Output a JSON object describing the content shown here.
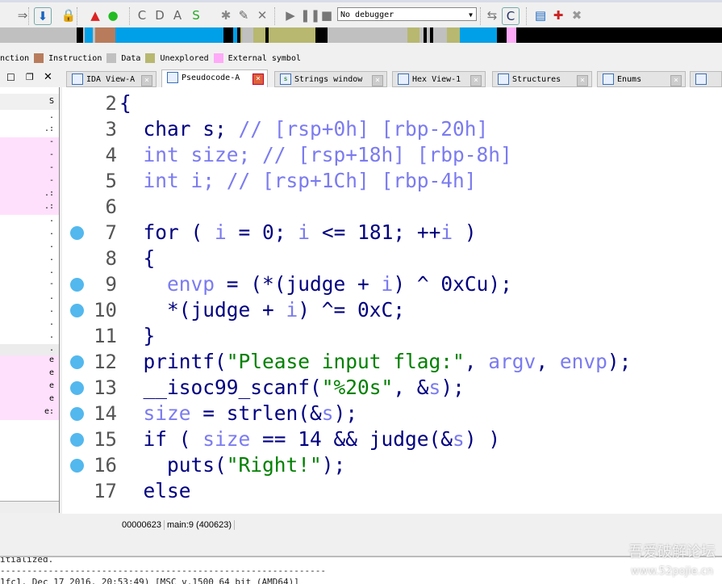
{
  "toolbar": {
    "debugger_select": "No debugger",
    "icons": [
      "jump-icon",
      "nav-down-icon",
      "lock-icon",
      "error-icon",
      "run-green-icon",
      "make-code-icon",
      "make-data-icon",
      "make-ascii-icon",
      "make-string-icon",
      "make-array-icon",
      "rename-icon",
      "undefine-icon",
      "play-icon",
      "pause-icon",
      "stop-icon",
      "attach-icon",
      "decompile-icon",
      "breakpoint-list-icon",
      "add-breakpoint-icon",
      "delete-breakpoint-icon"
    ]
  },
  "legend": [
    {
      "label": "nction",
      "color": null
    },
    {
      "label": "Instruction",
      "color": "#b87c5c"
    },
    {
      "label": "Data",
      "color": "#c0c0c0"
    },
    {
      "label": "Unexplored",
      "color": "#b8b870"
    },
    {
      "label": "External symbol",
      "color": "#ffaaf8"
    }
  ],
  "tabs": [
    {
      "label": "IDA View-A"
    },
    {
      "label": "Pseudocode-A",
      "active": true
    },
    {
      "label": "Strings window"
    },
    {
      "label": "Hex View-1"
    },
    {
      "label": "Structures"
    },
    {
      "label": "Enums"
    }
  ],
  "left_pane": {
    "header": "S",
    "rows": [
      ".",
      ".:",
      "-",
      "-",
      "-",
      "-",
      ".:",
      ".:",
      ".",
      ".",
      ".",
      ".",
      ".",
      "-",
      ".",
      ".",
      ".",
      ".",
      ".",
      "e",
      "e",
      "e",
      "e",
      "e:"
    ]
  },
  "code": {
    "lines": [
      {
        "n": "2",
        "bp": false,
        "segs": [
          [
            "{",
            "k"
          ]
        ]
      },
      {
        "n": "3",
        "bp": false,
        "segs": [
          [
            "  char s; ",
            "k"
          ],
          [
            "// [rsp+0h] [rbp-20h]",
            "v"
          ]
        ]
      },
      {
        "n": "4",
        "bp": false,
        "segs": [
          [
            "  int size; ",
            "v"
          ],
          [
            "// [rsp+18h] [rbp-8h]",
            "v"
          ]
        ]
      },
      {
        "n": "5",
        "bp": false,
        "segs": [
          [
            "  int i; ",
            "v"
          ],
          [
            "// [rsp+1Ch] [rbp-4h]",
            "v"
          ]
        ]
      },
      {
        "n": "6",
        "bp": false,
        "segs": []
      },
      {
        "n": "7",
        "bp": true,
        "segs": [
          [
            "  for ( ",
            "k"
          ],
          [
            "i",
            "v"
          ],
          [
            " = 0; ",
            "k"
          ],
          [
            "i",
            "v"
          ],
          [
            " <= 181; ++",
            "k"
          ],
          [
            "i",
            "v"
          ],
          [
            " )",
            "k"
          ]
        ]
      },
      {
        "n": "8",
        "bp": false,
        "segs": [
          [
            "  {",
            "k"
          ]
        ]
      },
      {
        "n": "9",
        "bp": true,
        "segs": [
          [
            "    ",
            "k"
          ],
          [
            "envp",
            "v"
          ],
          [
            " = (*(judge + ",
            "k"
          ],
          [
            "i",
            "v"
          ],
          [
            ") ^ 0xCu);",
            "k"
          ]
        ]
      },
      {
        "n": "10",
        "bp": true,
        "segs": [
          [
            "    *(judge + ",
            "k"
          ],
          [
            "i",
            "v"
          ],
          [
            ") ^= 0xC;",
            "k"
          ]
        ]
      },
      {
        "n": "11",
        "bp": false,
        "segs": [
          [
            "  }",
            "k"
          ]
        ]
      },
      {
        "n": "12",
        "bp": true,
        "segs": [
          [
            "  printf(",
            "k"
          ],
          [
            "\"Please input flag:\"",
            "s"
          ],
          [
            ", ",
            "k"
          ],
          [
            "argv",
            "v"
          ],
          [
            ", ",
            "k"
          ],
          [
            "envp",
            "v"
          ],
          [
            ");",
            "k"
          ]
        ]
      },
      {
        "n": "13",
        "bp": true,
        "segs": [
          [
            "  __isoc99_scanf(",
            "k"
          ],
          [
            "\"%20s\"",
            "s"
          ],
          [
            ", &",
            "k"
          ],
          [
            "s",
            "v"
          ],
          [
            ");",
            "k"
          ]
        ]
      },
      {
        "n": "14",
        "bp": true,
        "segs": [
          [
            "  ",
            "k"
          ],
          [
            "size",
            "v"
          ],
          [
            " = strlen(&",
            "k"
          ],
          [
            "s",
            "v"
          ],
          [
            ");",
            "k"
          ]
        ]
      },
      {
        "n": "15",
        "bp": true,
        "segs": [
          [
            "  if ( ",
            "k"
          ],
          [
            "size",
            "v"
          ],
          [
            " == 14 && judge(&",
            "k"
          ],
          [
            "s",
            "v"
          ],
          [
            ") )",
            "k"
          ]
        ]
      },
      {
        "n": "16",
        "bp": true,
        "segs": [
          [
            "    puts(",
            "k"
          ],
          [
            "\"Right!\"",
            "s"
          ],
          [
            ");",
            "k"
          ]
        ]
      },
      {
        "n": "17",
        "bp": false,
        "segs": [
          [
            "  else",
            "k"
          ]
        ]
      }
    ]
  },
  "status": {
    "address": "00000623",
    "location": "main:9 (400623)"
  },
  "output": {
    "lines": [
      "itialized.",
      "-------------------------------------------------------------",
      "1fc1, Dec 17 2016, 20:53:49) [MSC v.1500 64 bit (AMD64)]"
    ]
  },
  "watermark": {
    "line1": "吾爱破解论坛",
    "line2": "www.52pojie.cn"
  }
}
